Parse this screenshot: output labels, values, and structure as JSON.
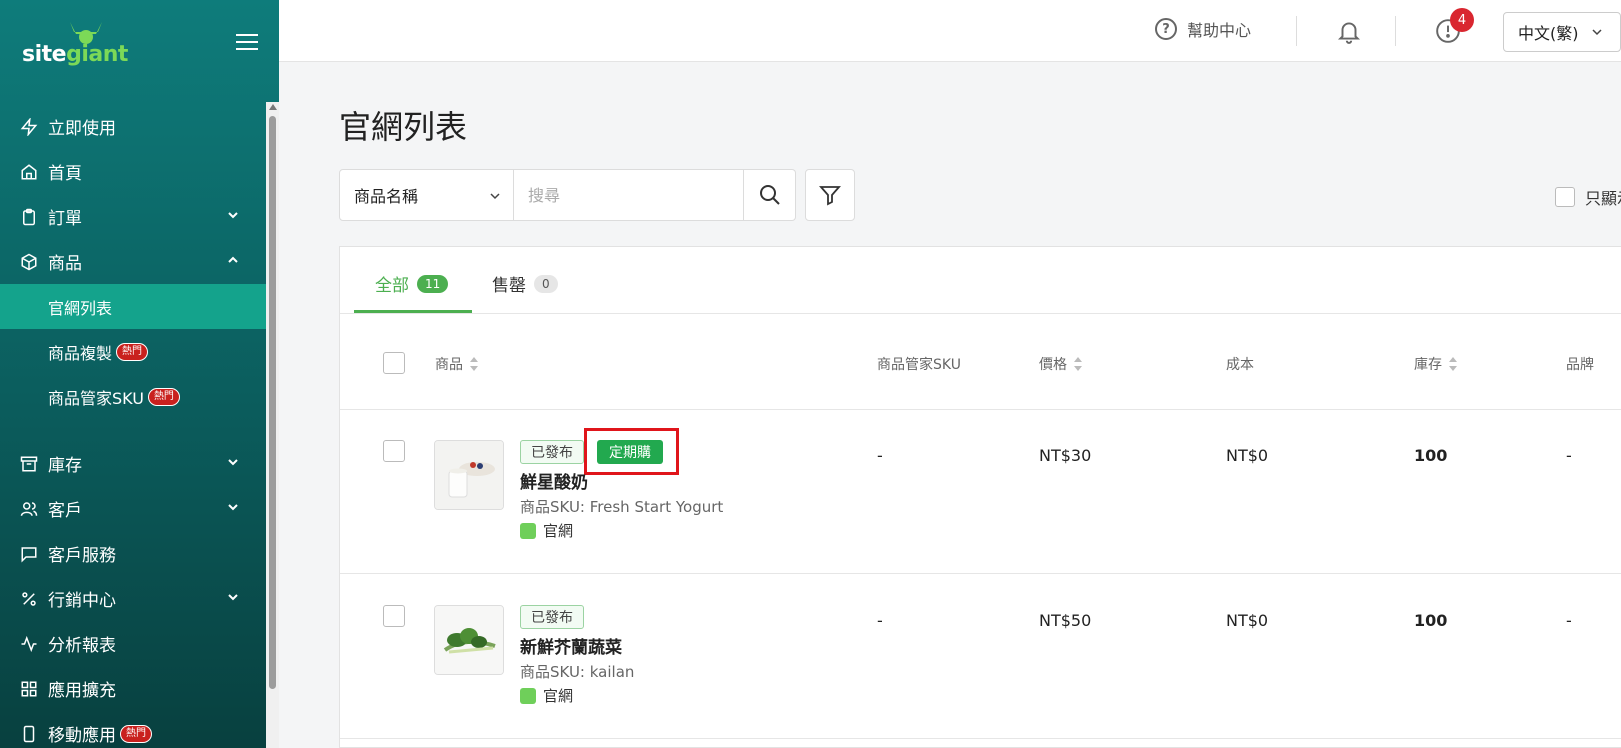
{
  "sidebar": {
    "logo": {
      "part1": "site",
      "part2": "giant"
    },
    "items": [
      {
        "label": "立即使用",
        "icon": "lightning-icon"
      },
      {
        "label": "首頁",
        "icon": "home-icon"
      },
      {
        "label": "訂單",
        "icon": "clipboard-icon"
      },
      {
        "label": "商品",
        "icon": "box-icon"
      }
    ],
    "sub_items": [
      {
        "label": "官網列表"
      },
      {
        "label": "商品複製",
        "badge": "熱門"
      },
      {
        "label": "商品管家SKU",
        "badge": "熱門"
      }
    ],
    "items2": [
      {
        "label": "庫存",
        "icon": "archive-icon"
      },
      {
        "label": "客戶",
        "icon": "users-icon"
      },
      {
        "label": "客戶服務",
        "icon": "chat-icon"
      },
      {
        "label": "行銷中心",
        "icon": "percent-icon"
      },
      {
        "label": "分析報表",
        "icon": "activity-icon"
      },
      {
        "label": "應用擴充",
        "icon": "grid-icon"
      },
      {
        "label": "移動應用",
        "icon": "mobile-icon",
        "badge": "熱門"
      }
    ]
  },
  "topbar": {
    "help_label": "幫助中心",
    "notification_count": "4",
    "language": "中文(繁)"
  },
  "main": {
    "title": "官網列表",
    "search": {
      "field_select": "商品名稱",
      "placeholder": "搜尋"
    },
    "only_show_label": "只顯示"
  },
  "tabs": [
    {
      "label": "全部",
      "count": "11"
    },
    {
      "label": "售罄",
      "count": "0"
    }
  ],
  "table": {
    "columns": [
      "商品",
      "商品管家SKU",
      "價格",
      "成本",
      "庫存",
      "品牌"
    ],
    "rows": [
      {
        "status": "已發布",
        "subscription_tag": "定期購",
        "name": "鮮星酸奶",
        "sku": "商品SKU: Fresh Start Yogurt",
        "channel": "官網",
        "manager_sku": "-",
        "price": "NT$30",
        "cost": "NT$0",
        "stock": "100",
        "brand": "-"
      },
      {
        "status": "已發布",
        "name": "新鮮芥蘭蔬菜",
        "sku": "商品SKU: kailan",
        "channel": "官網",
        "manager_sku": "-",
        "price": "NT$50",
        "cost": "NT$0",
        "stock": "100",
        "brand": "-"
      }
    ]
  },
  "colors": {
    "accent": "#4caf50",
    "sidebar_top": "#0e7c7b",
    "active_item": "#14a38c",
    "hot_badge": "#c9211e",
    "highlight": "#e0151b"
  }
}
